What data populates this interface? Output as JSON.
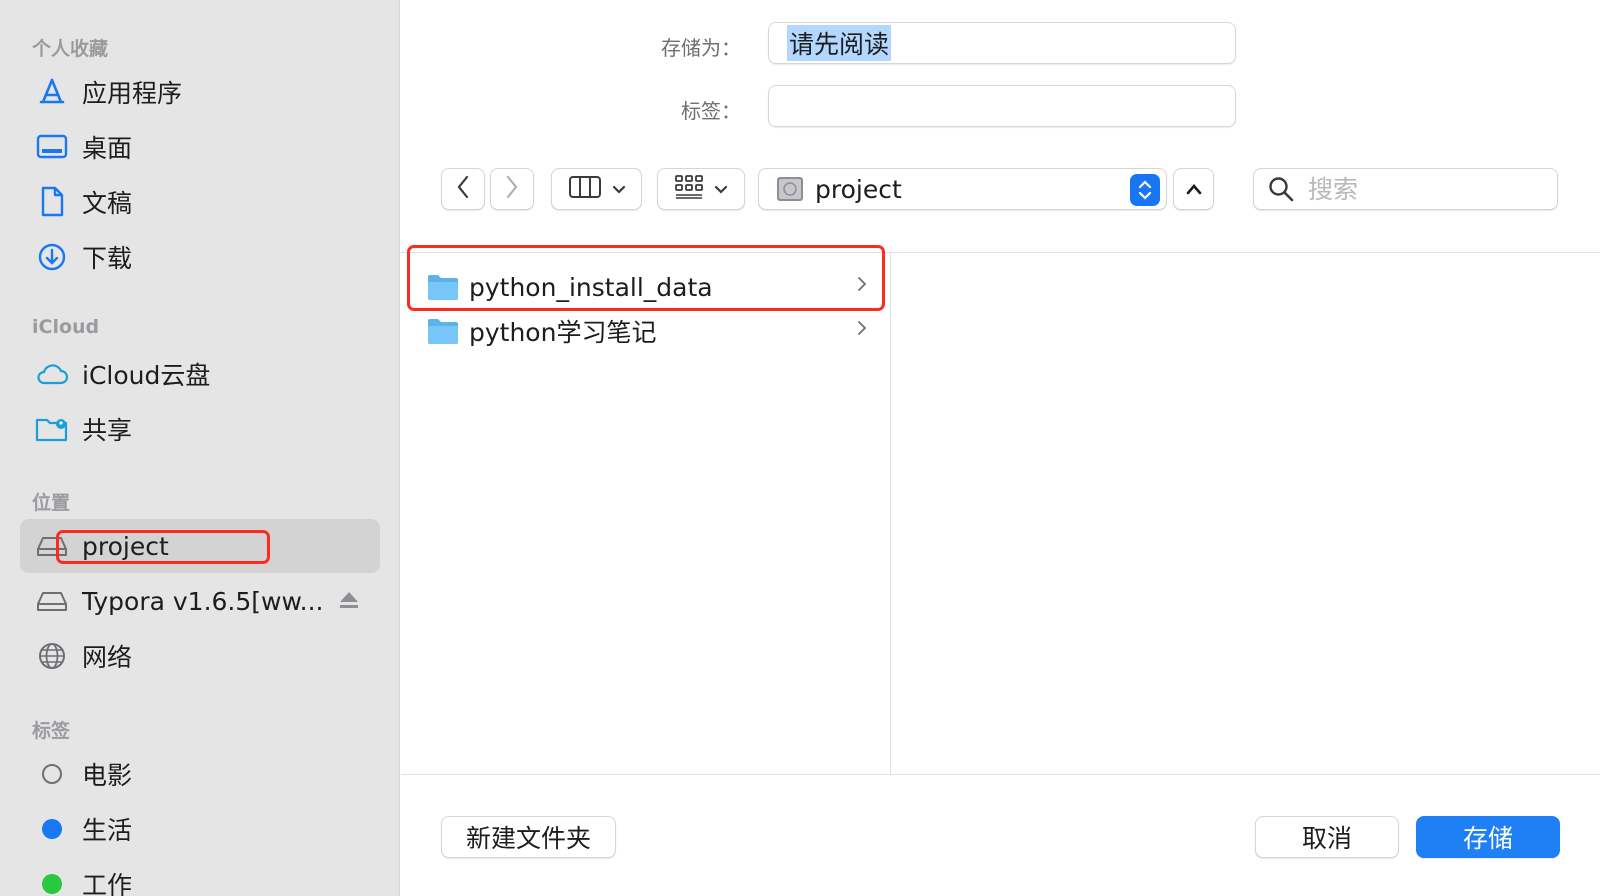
{
  "sidebar": {
    "sections": [
      {
        "title": "个人收藏",
        "items": [
          {
            "label": "应用程序",
            "icon": "applications-icon"
          },
          {
            "label": "桌面",
            "icon": "desktop-icon"
          },
          {
            "label": "文稿",
            "icon": "document-icon"
          },
          {
            "label": "下载",
            "icon": "download-icon"
          }
        ]
      },
      {
        "title": "iCloud",
        "items": [
          {
            "label": "iCloud云盘",
            "icon": "cloud-icon"
          },
          {
            "label": "共享",
            "icon": "shared-folder-icon"
          }
        ]
      },
      {
        "title": "位置",
        "items": [
          {
            "label": "project",
            "icon": "disk-icon",
            "selected": true
          },
          {
            "label": "Typora v1.6.5[ww...",
            "icon": "disk-icon",
            "eject": true
          },
          {
            "label": "网络",
            "icon": "network-globe-icon"
          }
        ]
      },
      {
        "title": "标签",
        "items": [
          {
            "label": "电影",
            "icon": "tag-empty-circle-icon"
          },
          {
            "label": "生活",
            "icon": "tag-blue-dot-icon",
            "color": "#1877f2"
          },
          {
            "label": "工作",
            "icon": "tag-green-dot-icon",
            "color": "#28c840"
          }
        ]
      }
    ]
  },
  "form": {
    "save_as_label": "存储为：",
    "save_as_value": "请先阅读",
    "tags_label": "标签：",
    "tags_value": ""
  },
  "toolbar": {
    "back_icon": "chevron-left-icon",
    "forward_icon": "chevron-right-icon",
    "view_columns_icon": "columns-view-icon",
    "group_icon": "grid-group-icon",
    "location": "project",
    "search_placeholder": "搜索"
  },
  "files": [
    {
      "name": "python_install_data",
      "icon": "folder-icon",
      "has_children": true
    },
    {
      "name": "python学习笔记",
      "icon": "folder-icon",
      "has_children": true
    }
  ],
  "footer": {
    "new_folder": "新建文件夹",
    "cancel": "取消",
    "save": "存储"
  },
  "colors": {
    "accent": "#1f7ff5",
    "highlight_box": "#ff2a1f",
    "sidebar_bg": "#e6e5e6"
  }
}
